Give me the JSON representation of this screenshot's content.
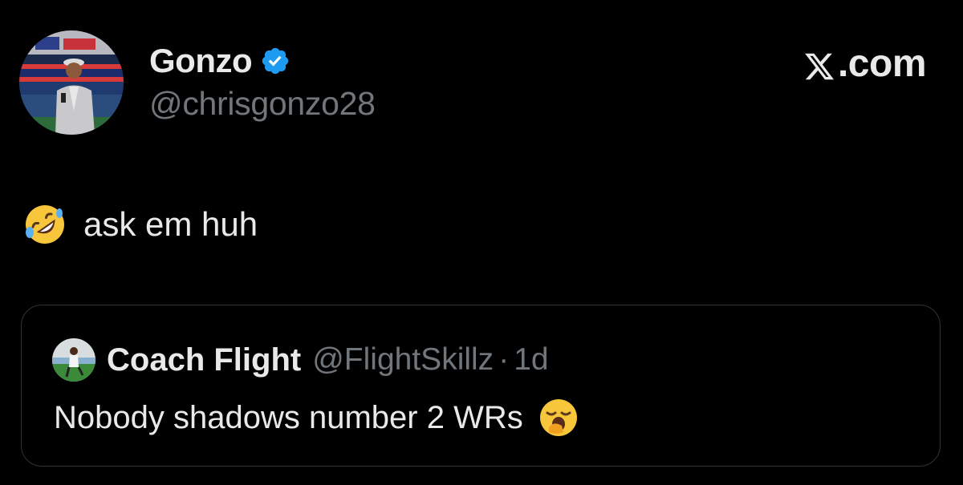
{
  "author": {
    "display_name": "Gonzo",
    "handle": "@chrisgonzo28",
    "avatar_icon": "profile-photo-avatar",
    "verified": true,
    "verified_color": "#1d9bf0"
  },
  "brand": {
    "label": ".com",
    "logo_icon": "x-logo-icon"
  },
  "tweet": {
    "emoji_icon": "rolling-on-floor-laughing-emoji",
    "text": "ask em huh"
  },
  "quote": {
    "display_name": "Coach Flight",
    "handle": "@FlightSkillz",
    "separator": "·",
    "time": "1d",
    "text": "Nobody shadows number 2 WRs",
    "emoji_icon": "yawning-face-emoji",
    "avatar_icon": "profile-photo-avatar"
  },
  "colors": {
    "background": "#000000",
    "primary_text": "#e7e9ea",
    "secondary_text": "#71767b",
    "border": "#2f3336"
  }
}
